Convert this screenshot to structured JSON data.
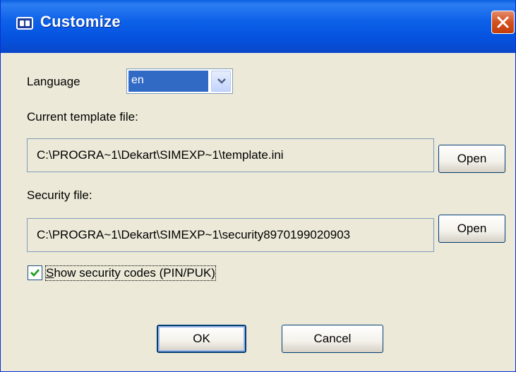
{
  "window": {
    "title": "Customize"
  },
  "language": {
    "label": "Language",
    "value": "en"
  },
  "template": {
    "label": "Current template file:",
    "path": "C:\\PROGRA~1\\Dekart\\SIMEXP~1\\template.ini",
    "open_label": "Open"
  },
  "security": {
    "label": "Security file:",
    "path": "C:\\PROGRA~1\\Dekart\\SIMEXP~1\\security8970199020903",
    "open_label": "Open"
  },
  "show_codes": {
    "label": "Show security codes (PIN/PUK)",
    "checked": true
  },
  "buttons": {
    "ok": "OK",
    "cancel": "Cancel"
  },
  "colors": {
    "title_bar": "#0553e0",
    "close_button": "#d2511f",
    "selection": "#316ac5",
    "dialog_bg": "#ece9d8"
  },
  "icons": {
    "app": "sim-card-icon",
    "close": "close-icon",
    "dropdown": "chevron-down-icon",
    "check": "checkmark-icon"
  }
}
